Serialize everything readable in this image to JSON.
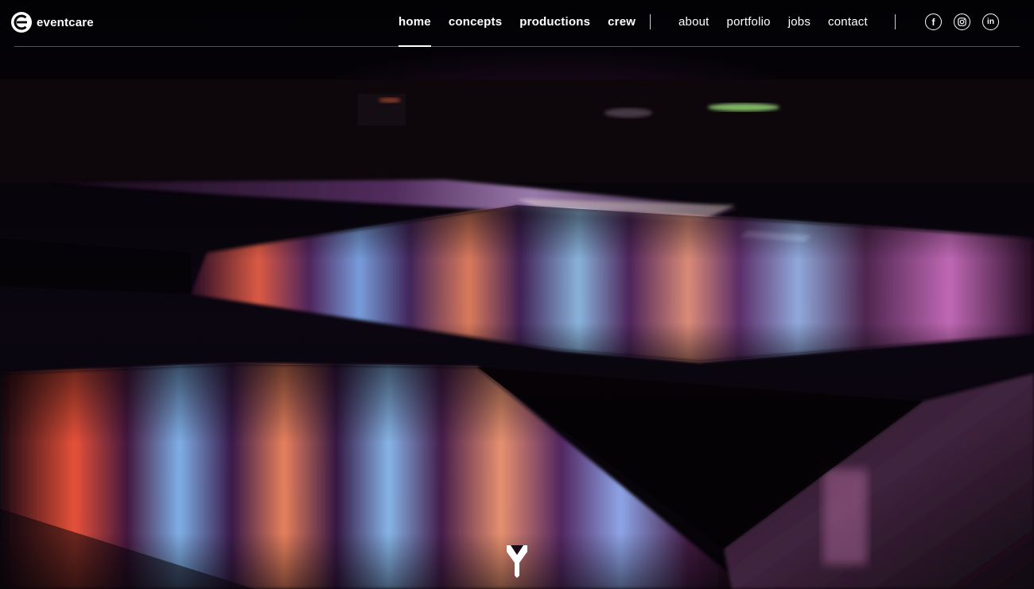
{
  "brand": {
    "name": "eventcare",
    "icon": "eventcare-logo-icon"
  },
  "nav_primary": {
    "items": [
      {
        "label": "home",
        "active": true
      },
      {
        "label": "concepts",
        "active": false
      },
      {
        "label": "productions",
        "active": false
      },
      {
        "label": "crew",
        "active": false
      }
    ]
  },
  "nav_secondary": {
    "items": [
      {
        "label": "about"
      },
      {
        "label": "portfolio"
      },
      {
        "label": "jobs"
      },
      {
        "label": "contact"
      }
    ]
  },
  "social": {
    "items": [
      {
        "icon": "facebook-icon",
        "glyph": "f"
      },
      {
        "icon": "instagram-icon",
        "glyph": ""
      },
      {
        "icon": "linkedin-icon",
        "glyph": "in"
      }
    ]
  },
  "hero": {
    "description_icon": "scroll-down-icon"
  },
  "colors": {
    "background": "#000000",
    "text": "#ffffff",
    "reflection_pink": "#d86fd8",
    "reflection_blue": "#7fb8ff",
    "reflection_orange": "#ff8a50"
  }
}
